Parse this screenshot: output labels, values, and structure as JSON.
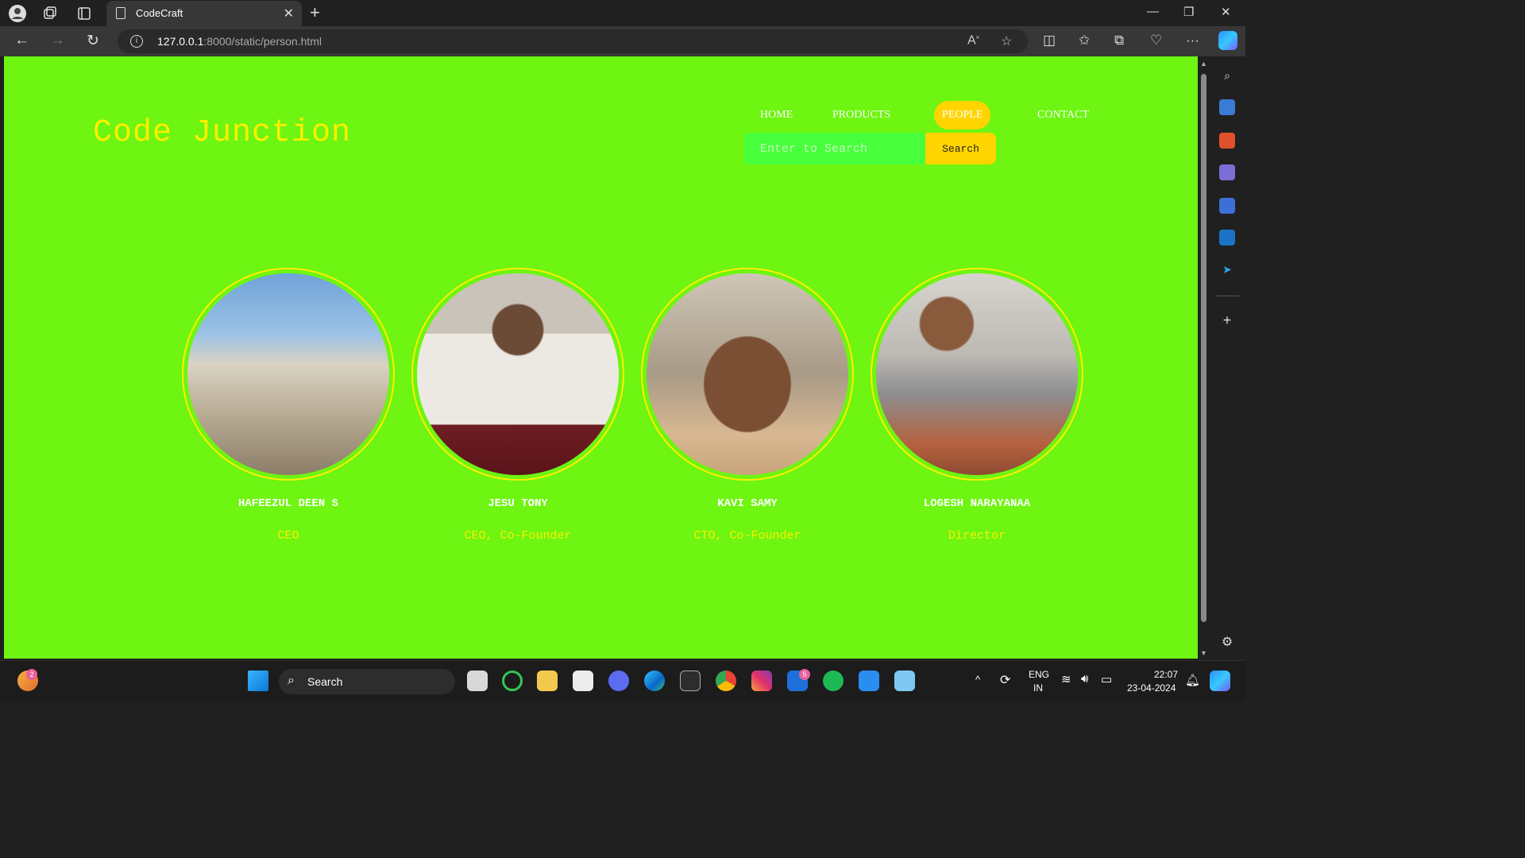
{
  "browser": {
    "tab_title": "CodeCraft",
    "url_host": "127.0.0.1",
    "url_path": ":8000/static/person.html"
  },
  "site": {
    "brand": "Code Junction",
    "nav": [
      "HOME",
      "PRODUCTS",
      "PEOPLE",
      "CONTACT"
    ],
    "active_nav": "PEOPLE",
    "search_placeholder": "Enter to Search",
    "search_button": "Search",
    "colors": {
      "background": "#6ef512",
      "accent": "#ffee00",
      "button": "#ffd400",
      "search_field": "#47ff3a"
    }
  },
  "people": [
    {
      "name": "HAFEEZUL DEEN S",
      "role": "CEO"
    },
    {
      "name": "JESU TONY",
      "role": "CEO, Co-Founder"
    },
    {
      "name": "KAVI SAMY",
      "role": "CTO, Co-Founder"
    },
    {
      "name": "LOGESH NARAYANAA",
      "role": "Director"
    }
  ],
  "taskbar": {
    "search_label": "Search",
    "language": "ENG",
    "region": "IN",
    "time": "22:07",
    "date": "23-04-2024",
    "weather_badge": "2",
    "mail_badge": "5"
  }
}
